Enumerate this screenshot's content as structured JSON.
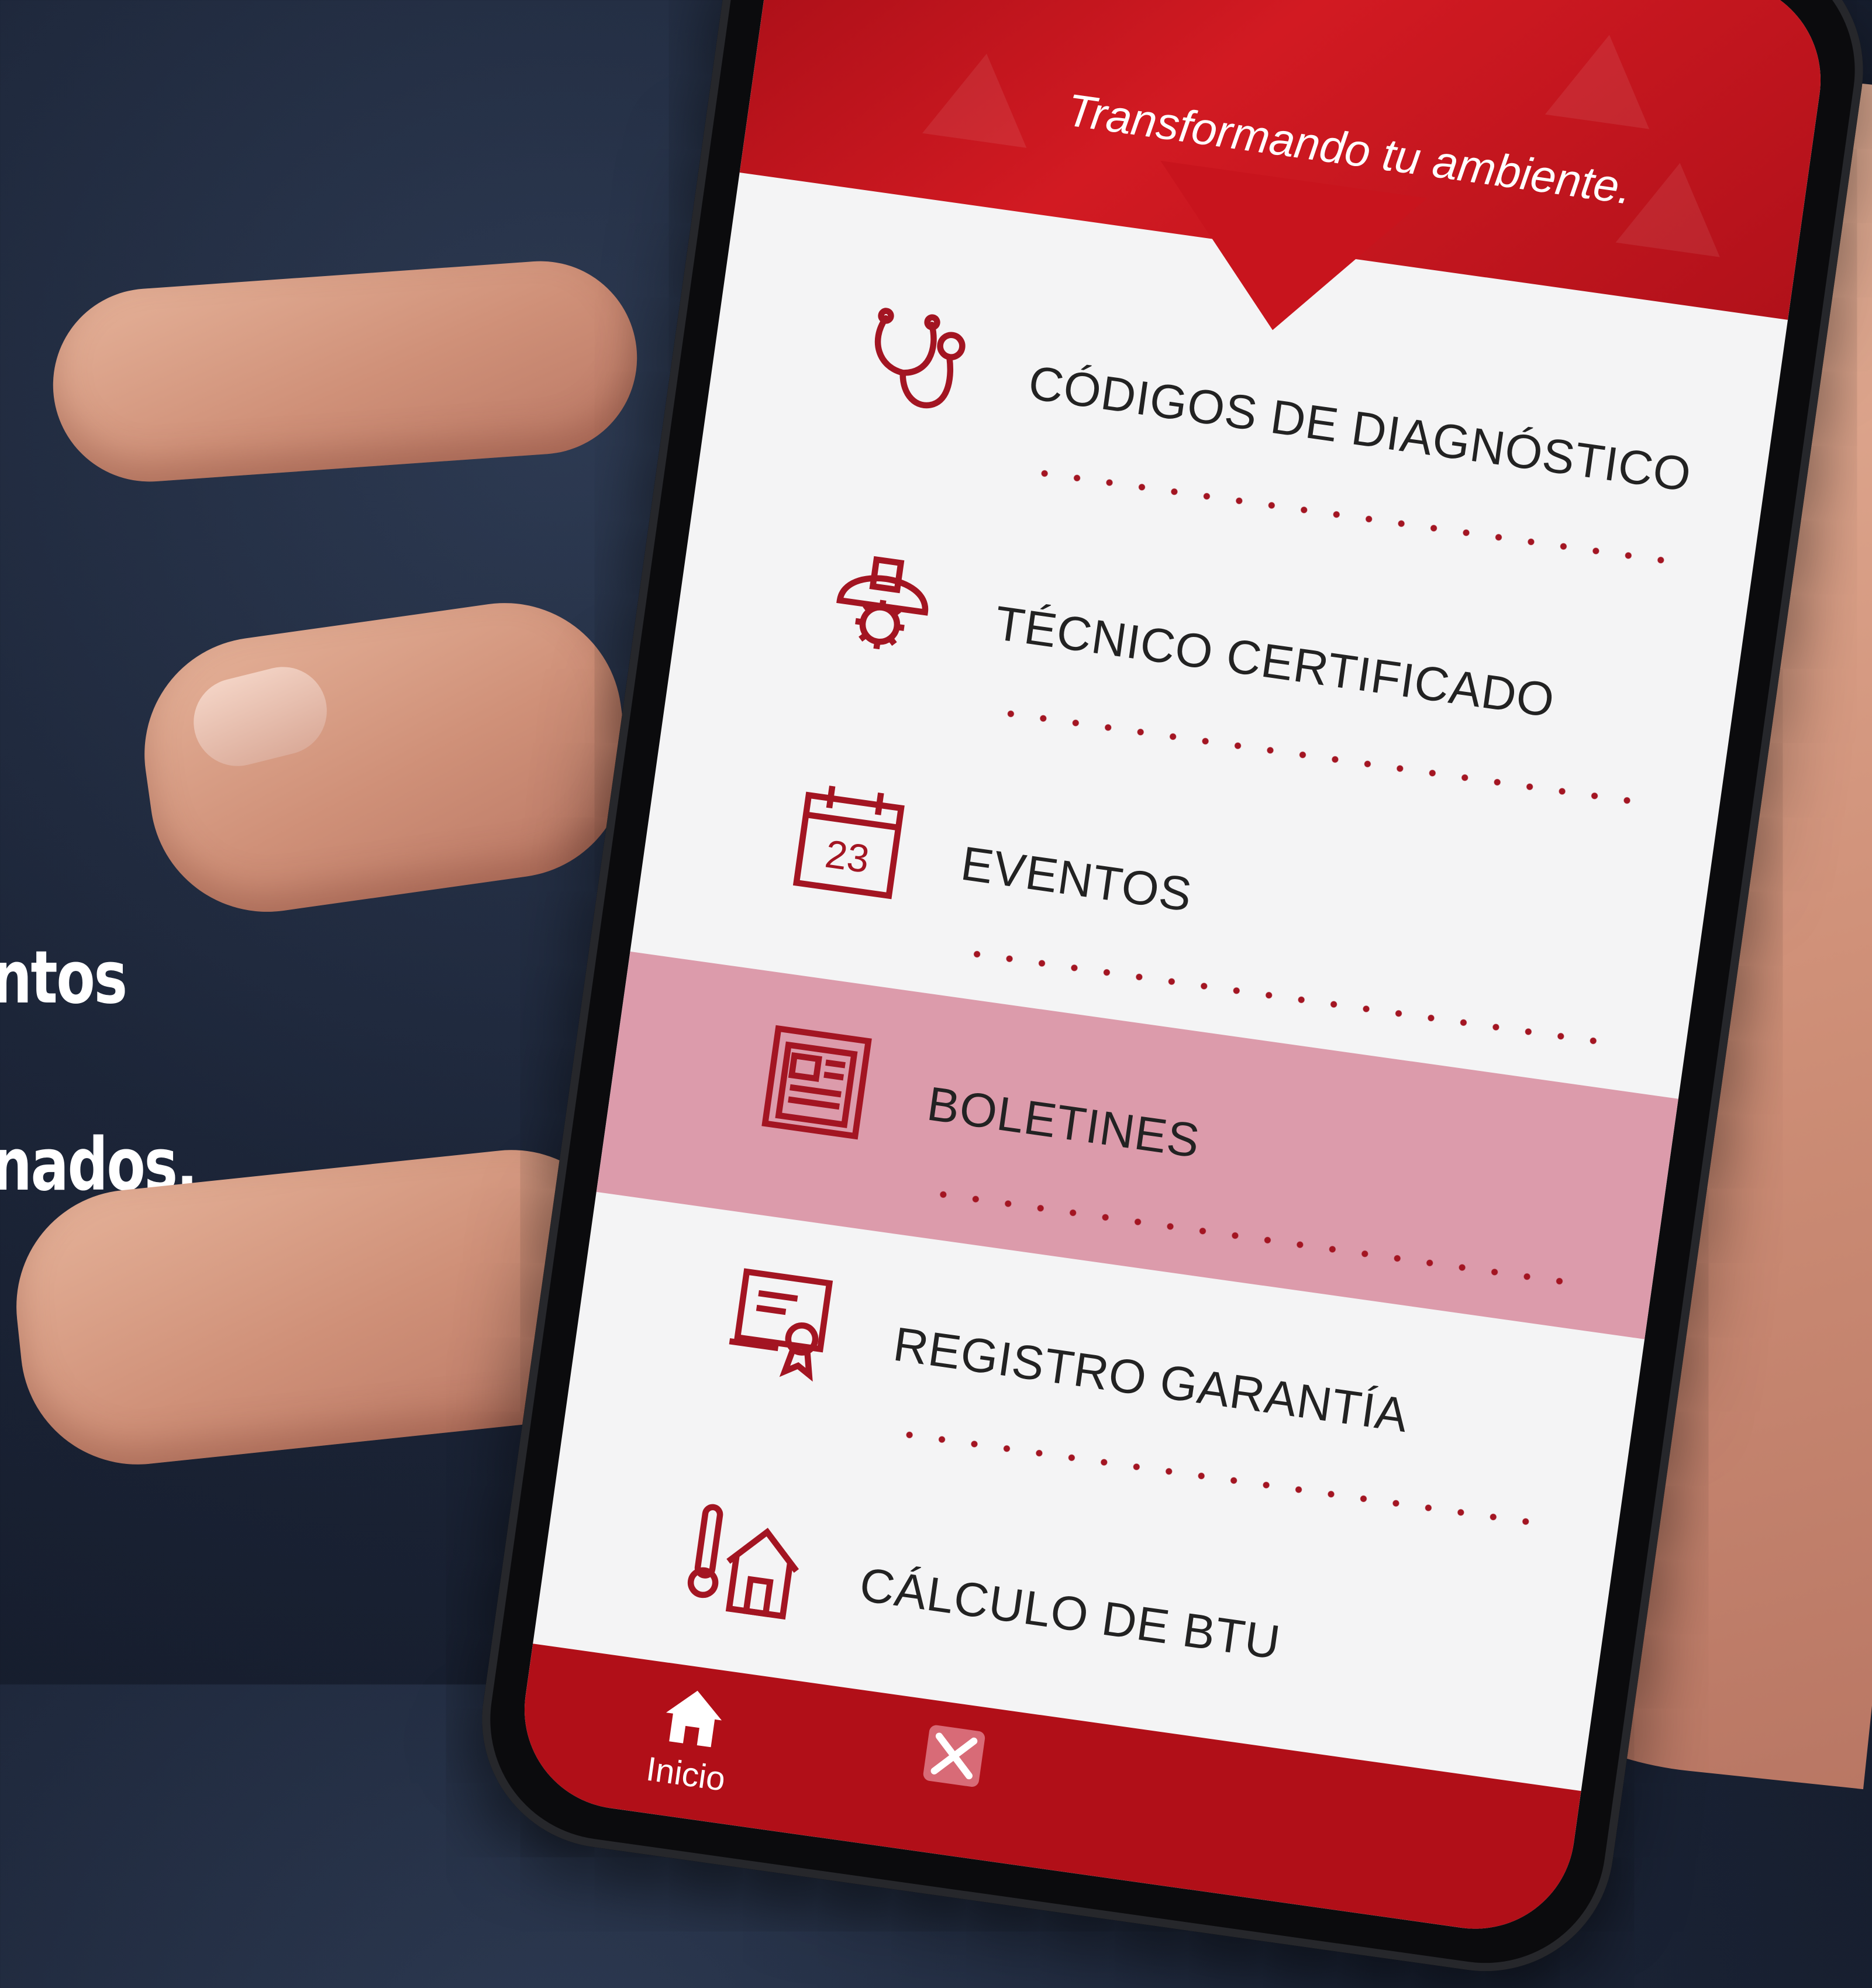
{
  "side_text": [
    "ntos",
    "nados."
  ],
  "app": {
    "tagline": "Transformando tu ambiente.",
    "brand_color": "#c8141d",
    "highlight_color": "#dc9bab"
  },
  "menu": {
    "items": [
      {
        "label": "CÓDIGOS DE DIAGNÓSTICO",
        "icon": "stethoscope-icon"
      },
      {
        "label": "TÉCNICO CERTIFICADO",
        "icon": "hardhat-gear-icon"
      },
      {
        "label": "EVENTOS",
        "icon": "calendar-icon",
        "icon_text": "23"
      },
      {
        "label": "BOLETINES",
        "icon": "newspaper-icon",
        "selected": true
      },
      {
        "label": "REGISTRO GARANTÍA",
        "icon": "certificate-icon"
      },
      {
        "label": "CÁLCULO DE BTU",
        "icon": "thermometer-house-icon"
      }
    ]
  },
  "tabbar": {
    "items": [
      {
        "label": "Inicio",
        "icon": "home-icon"
      },
      {
        "label": "",
        "icon": "tools-icon"
      }
    ]
  }
}
